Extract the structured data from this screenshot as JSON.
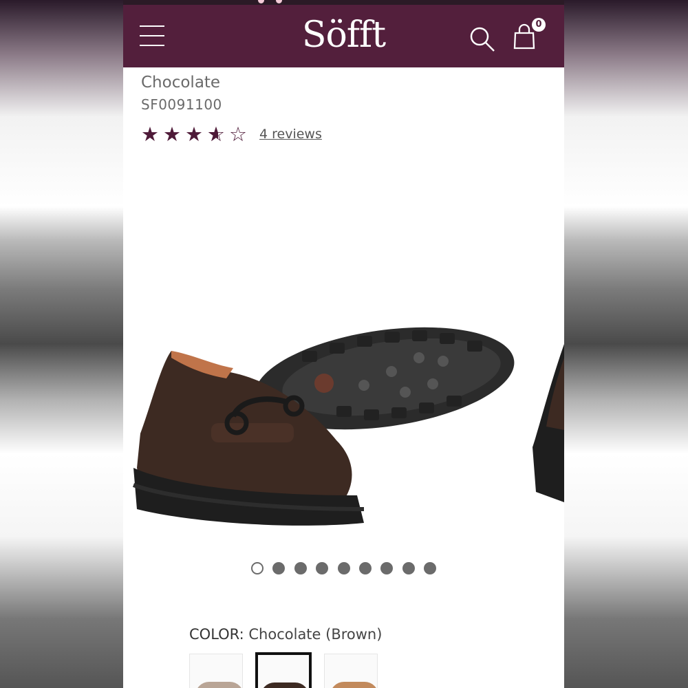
{
  "header": {
    "brand": "Söfft",
    "cart_count": "0",
    "bg_color": "#531f3c"
  },
  "product": {
    "color_name": "Chocolate",
    "sku": "SF0091100",
    "rating": 3.5,
    "rating_max": 5,
    "reviews_text": "4 reviews"
  },
  "gallery": {
    "total_slides": 9,
    "active_slide": 1
  },
  "color_selector": {
    "label": "COLOR:",
    "selected": "Chocolate (Brown)",
    "swatches": [
      {
        "name": "swatch-1",
        "selected": false
      },
      {
        "name": "swatch-2",
        "selected": true
      },
      {
        "name": "swatch-3",
        "selected": false
      }
    ]
  }
}
